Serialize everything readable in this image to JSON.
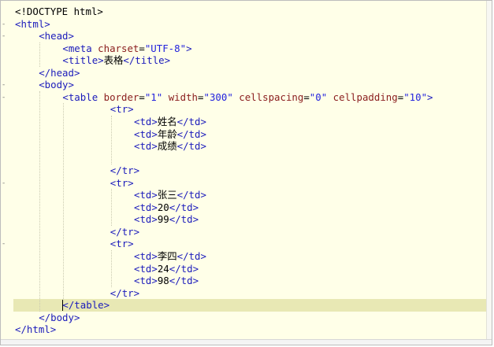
{
  "editor": {
    "lines": [
      {
        "indent": 0,
        "fold": "",
        "tokens": [
          [
            "x",
            "<!DOCTYPE html>"
          ]
        ]
      },
      {
        "indent": 0,
        "fold": "-",
        "tokens": [
          [
            "t",
            "<html>"
          ]
        ]
      },
      {
        "indent": 4,
        "fold": "-",
        "tokens": [
          [
            "t",
            "<head>"
          ]
        ]
      },
      {
        "indent": 8,
        "fold": "",
        "tokens": [
          [
            "t",
            "<meta "
          ],
          [
            "a",
            "charset"
          ],
          [
            "x",
            "="
          ],
          [
            "v",
            "\"UTF-8\""
          ],
          [
            "t",
            ">"
          ]
        ]
      },
      {
        "indent": 8,
        "fold": "",
        "tokens": [
          [
            "t",
            "<title>"
          ],
          [
            "x",
            "表格"
          ],
          [
            "t",
            "</title>"
          ]
        ]
      },
      {
        "indent": 4,
        "fold": "",
        "tokens": [
          [
            "t",
            "</head>"
          ]
        ]
      },
      {
        "indent": 4,
        "fold": "-",
        "tokens": [
          [
            "t",
            "<body>"
          ]
        ]
      },
      {
        "indent": 8,
        "fold": "-",
        "tokens": [
          [
            "t",
            "<table "
          ],
          [
            "a",
            "border"
          ],
          [
            "x",
            "="
          ],
          [
            "v",
            "\"1\""
          ],
          [
            "x",
            " "
          ],
          [
            "a",
            "width"
          ],
          [
            "x",
            "="
          ],
          [
            "v",
            "\"300\""
          ],
          [
            "x",
            " "
          ],
          [
            "a",
            "cellspacing"
          ],
          [
            "x",
            "="
          ],
          [
            "v",
            "\"0\""
          ],
          [
            "x",
            " "
          ],
          [
            "a",
            "cellpadding"
          ],
          [
            "x",
            "="
          ],
          [
            "v",
            "\"10\""
          ],
          [
            "t",
            ">"
          ]
        ]
      },
      {
        "indent": 16,
        "fold": "",
        "tokens": [
          [
            "t",
            "<tr>"
          ]
        ]
      },
      {
        "indent": 20,
        "fold": "",
        "tokens": [
          [
            "t",
            "<td>"
          ],
          [
            "x",
            "姓名"
          ],
          [
            "t",
            "</td>"
          ]
        ]
      },
      {
        "indent": 20,
        "fold": "",
        "tokens": [
          [
            "t",
            "<td>"
          ],
          [
            "x",
            "年龄"
          ],
          [
            "t",
            "</td>"
          ]
        ]
      },
      {
        "indent": 20,
        "fold": "",
        "tokens": [
          [
            "t",
            "<td>"
          ],
          [
            "x",
            "成绩"
          ],
          [
            "t",
            "</td>"
          ]
        ]
      },
      {
        "indent": 0,
        "fold": "",
        "tokens": []
      },
      {
        "indent": 16,
        "fold": "",
        "tokens": [
          [
            "t",
            "</tr>"
          ]
        ]
      },
      {
        "indent": 16,
        "fold": "-",
        "tokens": [
          [
            "t",
            "<tr>"
          ]
        ]
      },
      {
        "indent": 20,
        "fold": "",
        "tokens": [
          [
            "t",
            "<td>"
          ],
          [
            "x",
            "张三"
          ],
          [
            "t",
            "</td>"
          ]
        ]
      },
      {
        "indent": 20,
        "fold": "",
        "tokens": [
          [
            "t",
            "<td>"
          ],
          [
            "x",
            "20"
          ],
          [
            "t",
            "</td>"
          ]
        ]
      },
      {
        "indent": 20,
        "fold": "",
        "tokens": [
          [
            "t",
            "<td>"
          ],
          [
            "x",
            "99"
          ],
          [
            "t",
            "</td>"
          ]
        ]
      },
      {
        "indent": 16,
        "fold": "",
        "tokens": [
          [
            "t",
            "</tr>"
          ]
        ]
      },
      {
        "indent": 16,
        "fold": "-",
        "tokens": [
          [
            "t",
            "<tr>"
          ]
        ]
      },
      {
        "indent": 20,
        "fold": "",
        "tokens": [
          [
            "t",
            "<td>"
          ],
          [
            "x",
            "李四"
          ],
          [
            "t",
            "</td>"
          ]
        ]
      },
      {
        "indent": 20,
        "fold": "",
        "tokens": [
          [
            "t",
            "<td>"
          ],
          [
            "x",
            "24"
          ],
          [
            "t",
            "</td>"
          ]
        ]
      },
      {
        "indent": 20,
        "fold": "",
        "tokens": [
          [
            "t",
            "<td>"
          ],
          [
            "x",
            "98"
          ],
          [
            "t",
            "</td>"
          ]
        ]
      },
      {
        "indent": 16,
        "fold": "",
        "tokens": [
          [
            "t",
            "</tr>"
          ]
        ]
      },
      {
        "indent": 8,
        "fold": "",
        "tokens": [
          [
            "t",
            "</table>"
          ]
        ],
        "current": true
      },
      {
        "indent": 4,
        "fold": "",
        "tokens": [
          [
            "t",
            "</body>"
          ]
        ]
      },
      {
        "indent": 0,
        "fold": "",
        "tokens": [
          [
            "t",
            "</html>"
          ]
        ]
      }
    ]
  },
  "colors": {
    "tag": "#1b1bbb",
    "attribute": "#8a1d1d",
    "value": "#2222dd",
    "background": "#ffffe8",
    "current_line": "#e8e8b4"
  }
}
